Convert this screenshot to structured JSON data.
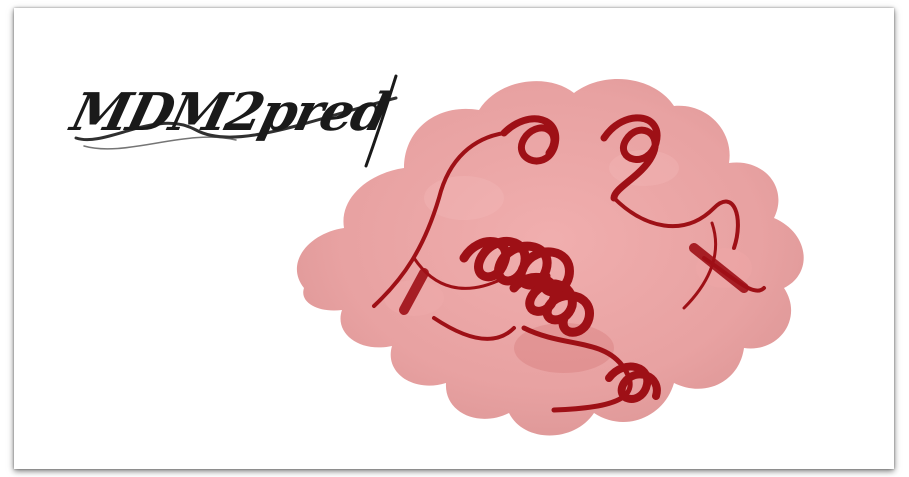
{
  "banner": {
    "logo_text": "MDM2pred",
    "background": "#ffffff"
  },
  "structure": {
    "icon": "protein-structure-icon",
    "surface_color": "#e28a8a",
    "ribbon_color": "#9e1016"
  }
}
